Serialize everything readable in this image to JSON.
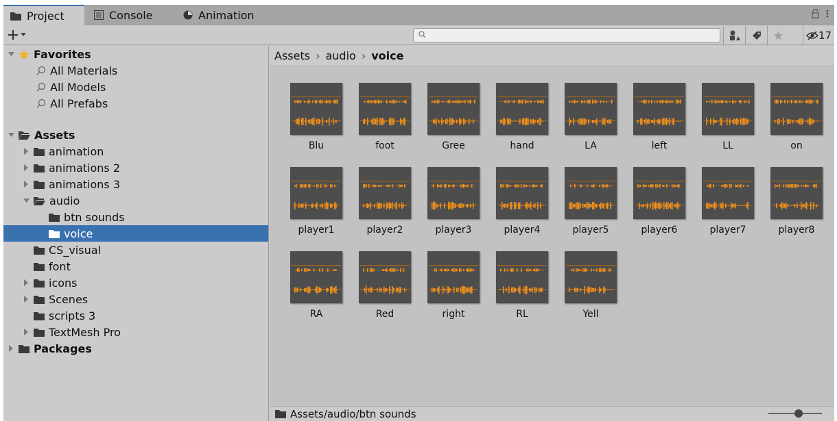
{
  "tabs": [
    {
      "label": "Project",
      "icon": "folder-icon",
      "active": true
    },
    {
      "label": "Console",
      "icon": "console-icon",
      "active": false
    },
    {
      "label": "Animation",
      "icon": "animation-icon",
      "active": false
    }
  ],
  "toolbar": {
    "search_placeholder": "",
    "hidden_count": "17"
  },
  "sidebar": {
    "favorites_label": "Favorites",
    "favorites": [
      "All Materials",
      "All Models",
      "All Prefabs"
    ],
    "assets_label": "Assets",
    "assets": [
      {
        "label": "animation"
      },
      {
        "label": "animations 2"
      },
      {
        "label": "animations 3"
      },
      {
        "label": "audio"
      },
      {
        "label": "btn sounds"
      },
      {
        "label": "voice"
      },
      {
        "label": "CS_visual"
      },
      {
        "label": "font"
      },
      {
        "label": "icons"
      },
      {
        "label": "Scenes"
      },
      {
        "label": "scripts 3"
      },
      {
        "label": "TextMesh Pro"
      }
    ],
    "packages_label": "Packages"
  },
  "breadcrumb": {
    "items": [
      "Assets",
      "audio",
      "voice"
    ]
  },
  "assets_grid": {
    "row1": [
      "Blu",
      "foot",
      "Gree",
      "hand",
      "LA",
      "left",
      "LL",
      "on"
    ],
    "row2": [
      "player1",
      "player2",
      "player3",
      "player4",
      "player5",
      "player6",
      "player7",
      "player8"
    ],
    "row3": [
      "RA",
      "Red",
      "right",
      "RL",
      "Yell"
    ]
  },
  "statusbar": {
    "path": "Assets/audio/btn sounds"
  },
  "colors": {
    "selection": "#3a72b0",
    "waveform": "#f0901c",
    "thumb_bg": "#4d4d4d"
  }
}
